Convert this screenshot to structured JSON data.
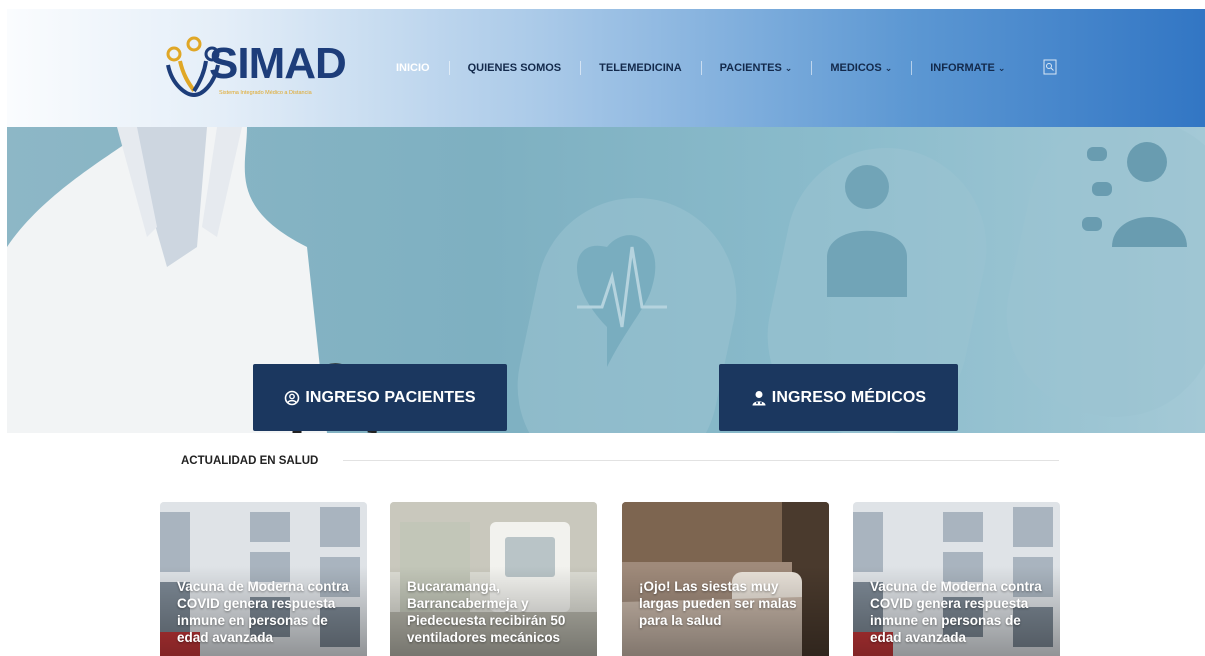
{
  "header": {
    "logo": {
      "word": "SIMAD",
      "subtitle": "Sistema Integrado Médico a Distancia"
    },
    "nav": [
      {
        "label": "INICIO",
        "active": true,
        "dropdown": false
      },
      {
        "label": "QUIENES SOMOS",
        "active": false,
        "dropdown": false
      },
      {
        "label": "TELEMEDICINA",
        "active": false,
        "dropdown": false
      },
      {
        "label": "PACIENTES",
        "active": false,
        "dropdown": true
      },
      {
        "label": "MEDICOS",
        "active": false,
        "dropdown": true
      },
      {
        "label": "INFORMATE",
        "active": false,
        "dropdown": true
      }
    ],
    "search_icon": "search-icon"
  },
  "hero": {
    "patients_button": "INGRESO PACIENTES",
    "doctors_button": "INGRESO MÉDICOS",
    "patients_icon": "user-circle-icon",
    "doctors_icon": "doctor-icon"
  },
  "section": {
    "title": "ACTUALIDAD EN SALUD"
  },
  "news": [
    {
      "title": "Vacuna de Moderna contra COVID genera respuesta inmune en personas de edad avanzada"
    },
    {
      "title": "Bucaramanga, Barrancabermeja y Piedecuesta recibirán 50 ventiladores mecánicos"
    },
    {
      "title": "¡Ojo! Las siestas muy largas pueden ser malas para la salud"
    },
    {
      "title": "Vacuna de Moderna contra COVID genera respuesta inmune en personas de edad avanzada"
    }
  ],
  "colors": {
    "brand_navy": "#1b375f",
    "logo_blue": "#1d3d7a",
    "logo_gold": "#e0a726",
    "header_gradient_end": "#3276c4",
    "hero_teal": "#7eb0c1"
  }
}
